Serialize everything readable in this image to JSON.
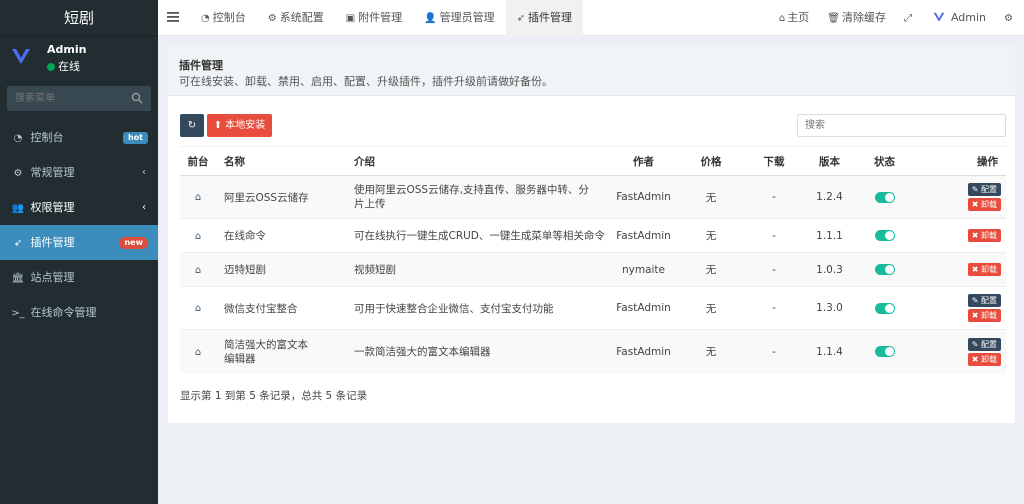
{
  "brand": {
    "logo_text": "短剧",
    "user_name": "Admin",
    "user_status": "在线"
  },
  "sidebar": {
    "search_placeholder": "搜索菜单",
    "items": [
      {
        "label": "控制台",
        "icon": "dashboard-icon",
        "badge": "hot"
      },
      {
        "label": "常规管理",
        "icon": "cogs-icon"
      },
      {
        "label": "权限管理",
        "icon": "group-icon"
      },
      {
        "label": "插件管理",
        "icon": "rocket-icon",
        "badge": "new"
      },
      {
        "label": "站点管理",
        "icon": "bank-icon"
      },
      {
        "label": "在线命令管理",
        "icon": "terminal-icon"
      }
    ]
  },
  "topbar": {
    "tabs": [
      {
        "label": "控制台",
        "icon": "dashboard-icon"
      },
      {
        "label": "系统配置",
        "icon": "cog-icon"
      },
      {
        "label": "附件管理",
        "icon": "file-image-icon"
      },
      {
        "label": "管理员管理",
        "icon": "user-icon"
      },
      {
        "label": "插件管理",
        "icon": "rocket-icon"
      }
    ],
    "right": {
      "home": "主页",
      "clear_cache": "清除缓存",
      "user": "Admin"
    }
  },
  "header": {
    "title": "插件管理",
    "desc": "可在线安装、卸载、禁用、启用、配置、升级插件，插件升级前请做好备份。"
  },
  "toolbar": {
    "install_label": "本地安装",
    "search_placeholder": "搜索"
  },
  "table": {
    "columns": [
      "前台",
      "名称",
      "介绍",
      "作者",
      "价格",
      "下载",
      "版本",
      "状态",
      "操作"
    ],
    "rows": [
      {
        "name": "阿里云OSS云储存",
        "intro": "使用阿里云OSS云储存,支持直传、服务器中转、分片上传",
        "author": "FastAdmin",
        "price": "无",
        "downloads": "-",
        "version": "1.2.4",
        "has_config": true
      },
      {
        "name": "在线命令",
        "intro": "可在线执行一键生成CRUD、一键生成菜单等相关命令",
        "author": "FastAdmin",
        "price": "无",
        "downloads": "-",
        "version": "1.1.1",
        "has_config": false
      },
      {
        "name": "迈特短剧",
        "intro": "视频短剧",
        "author": "nymaite",
        "price": "无",
        "downloads": "-",
        "version": "1.0.3",
        "has_config": false
      },
      {
        "name": "微信支付宝整合",
        "intro": "可用于快速整合企业微信、支付宝支付功能",
        "author": "FastAdmin",
        "price": "无",
        "downloads": "-",
        "version": "1.3.0",
        "has_config": true
      },
      {
        "name": "简洁强大的富文本编辑器",
        "intro": "一款简洁强大的富文本编辑器",
        "author": "FastAdmin",
        "price": "无",
        "downloads": "-",
        "version": "1.1.4",
        "has_config": true
      }
    ],
    "config_label": "配置",
    "uninstall_label": "卸载"
  },
  "footer": {
    "summary": "显示第 1 到第 5 条记录，总共 5 条记录"
  }
}
